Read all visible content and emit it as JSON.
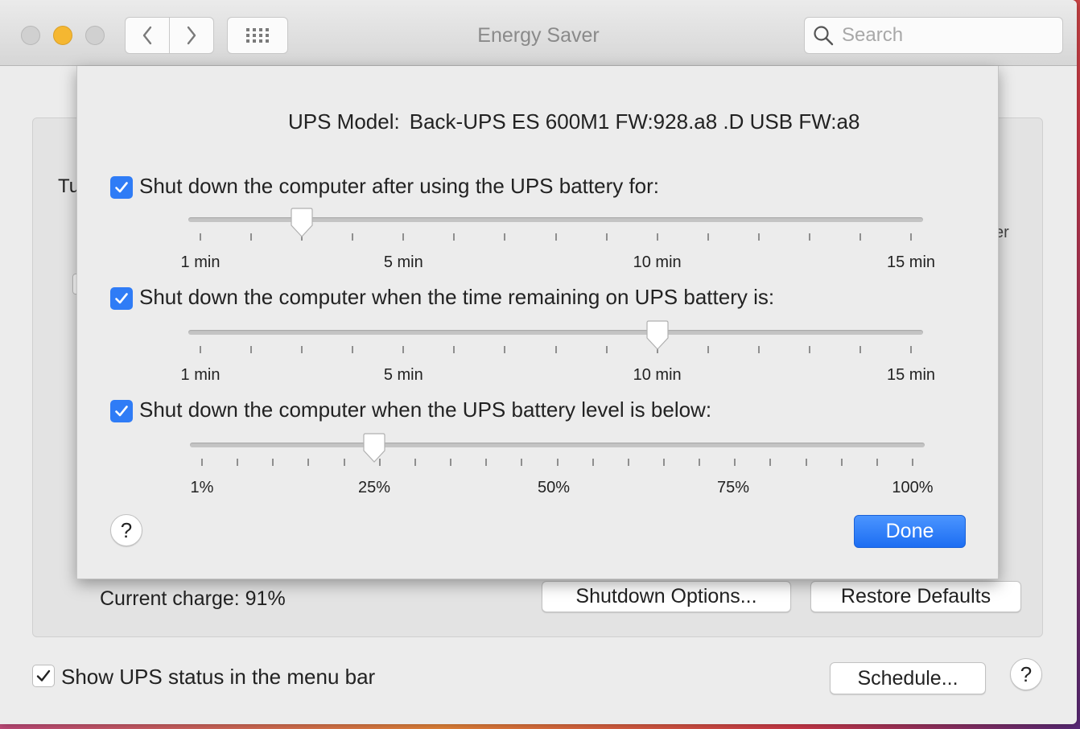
{
  "window": {
    "title": "Energy Saver",
    "search_placeholder": "Search"
  },
  "background": {
    "partial_label_left": "Tu",
    "partial_label_right": "er",
    "current_charge": "Current charge: 91%",
    "shutdown_options_button": "Shutdown Options...",
    "restore_defaults_button": "Restore Defaults",
    "show_ups_status": {
      "label": "Show UPS status in the menu bar",
      "checked": true
    },
    "schedule_button": "Schedule...",
    "help_glyph": "?"
  },
  "sheet": {
    "ups_model_label": "UPS Model:",
    "ups_model_value": "Back-UPS ES 600M1 FW:928.a8 .D USB FW:a8",
    "options": [
      {
        "label": "Shut down the computer after using the UPS battery for:",
        "checked": true,
        "slider": {
          "min": 1,
          "max": 15,
          "unit": "min",
          "value": 3,
          "tick_count": 15,
          "tick_labels": [
            "1 min",
            "5 min",
            "10 min",
            "15 min"
          ],
          "tick_label_values": [
            1,
            5,
            10,
            15
          ]
        }
      },
      {
        "label": "Shut down the computer when the time remaining on UPS battery is:",
        "checked": true,
        "slider": {
          "min": 1,
          "max": 15,
          "unit": "min",
          "value": 10,
          "tick_count": 15,
          "tick_labels": [
            "1 min",
            "5 min",
            "10 min",
            "15 min"
          ],
          "tick_label_values": [
            1,
            5,
            10,
            15
          ]
        }
      },
      {
        "label": "Shut down the computer when the UPS battery level is below:",
        "checked": true,
        "slider": {
          "min": 1,
          "max": 100,
          "unit": "%",
          "value": 25,
          "tick_count": 21,
          "tick_labels": [
            "1%",
            "25%",
            "50%",
            "75%",
            "100%"
          ],
          "tick_label_values": [
            1,
            25,
            50,
            75,
            100
          ]
        }
      }
    ],
    "help_glyph": "?",
    "done_button": "Done"
  },
  "colors": {
    "accent": "#2f7cf6",
    "minimize": "#f5b731"
  }
}
